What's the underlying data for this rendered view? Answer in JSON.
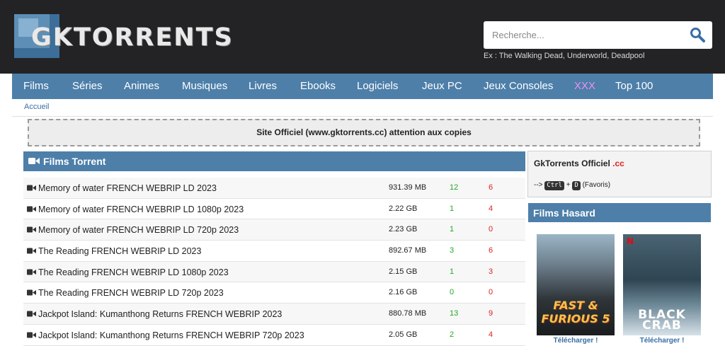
{
  "header": {
    "logo_text": "GKTORRENTS",
    "search_placeholder": "Recherche...",
    "search_hint": "Ex : The Walking Dead, Underworld, Deadpool"
  },
  "nav": {
    "items": [
      {
        "label": "Films"
      },
      {
        "label": "Séries"
      },
      {
        "label": "Animes"
      },
      {
        "label": "Musiques"
      },
      {
        "label": "Livres"
      },
      {
        "label": "Ebooks"
      },
      {
        "label": "Logiciels"
      },
      {
        "label": "Jeux PC"
      },
      {
        "label": "Jeux Consoles"
      },
      {
        "label": "XXX"
      },
      {
        "label": "Top 100"
      }
    ],
    "highlight_color": "#f08ef2"
  },
  "breadcrumb": "Accueil",
  "notice": "Site Officiel (www.gktorrents.cc) attention aux copies",
  "main": {
    "title": "Films Torrent",
    "rows": [
      {
        "name": "Memory of water FRENCH WEBRIP LD 2023",
        "size": "931.39 MB",
        "seeds": "12",
        "leechers": "6"
      },
      {
        "name": "Memory of water FRENCH WEBRIP LD 1080p 2023",
        "size": "2.22 GB",
        "seeds": "1",
        "leechers": "4"
      },
      {
        "name": "Memory of water FRENCH WEBRIP LD 720p 2023",
        "size": "2.23 GB",
        "seeds": "1",
        "leechers": "0"
      },
      {
        "name": "The Reading FRENCH WEBRIP LD 2023",
        "size": "892.67 MB",
        "seeds": "3",
        "leechers": "6"
      },
      {
        "name": "The Reading FRENCH WEBRIP LD 1080p 2023",
        "size": "2.15 GB",
        "seeds": "1",
        "leechers": "3"
      },
      {
        "name": "The Reading FRENCH WEBRIP LD 720p 2023",
        "size": "2.16 GB",
        "seeds": "0",
        "leechers": "0"
      },
      {
        "name": "Jackpot Island: Kumanthong Returns FRENCH WEBRIP 2023",
        "size": "880.78 MB",
        "seeds": "13",
        "leechers": "9"
      },
      {
        "name": "Jackpot Island: Kumanthong Returns FRENCH WEBRIP 720p 2023",
        "size": "2.05 GB",
        "seeds": "2",
        "leechers": "4"
      }
    ]
  },
  "sidebar": {
    "official_title": "GkTorrents Officiel",
    "official_tld": ".cc",
    "shortcut_arrow": "-->",
    "key_ctrl": "Ctrl",
    "key_plus": "+",
    "key_d": "D",
    "shortcut_label": "(Favoris)",
    "random_title": "Films Hasard",
    "posters": [
      {
        "title": "FAST & FURIOUS 5",
        "download": "Télécharger !"
      },
      {
        "title": "BLACK CRAB",
        "badge": "N",
        "download": "Télécharger !"
      }
    ]
  },
  "colors": {
    "header_bg": "#232325",
    "accent": "#4d7fa9",
    "seed": "#22aa22",
    "leech": "#dd2222"
  }
}
